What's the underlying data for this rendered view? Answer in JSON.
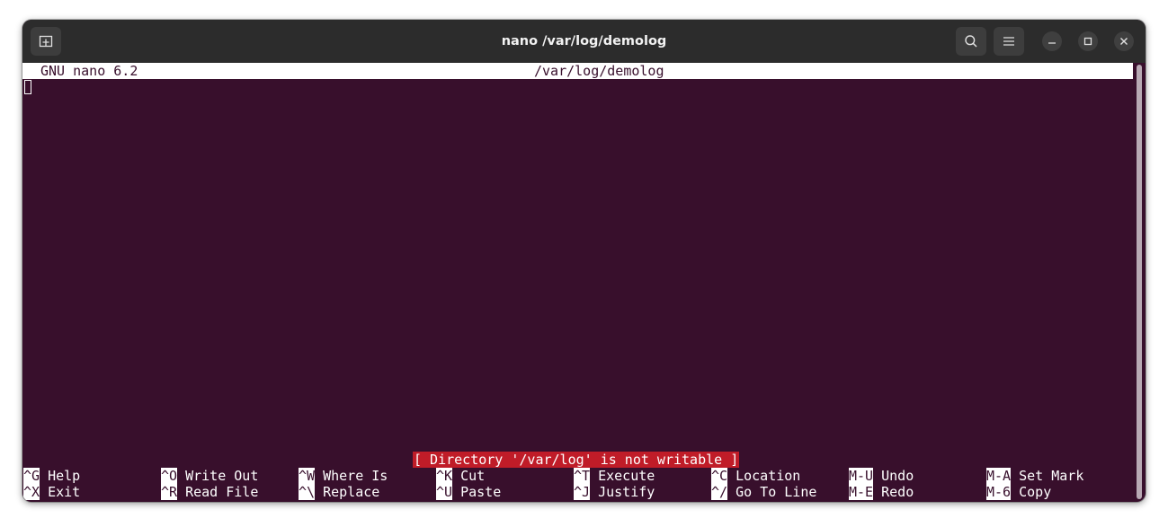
{
  "window": {
    "title": "nano /var/log/demolog",
    "new_tab_icon": "new-tab-icon",
    "search_icon": "search-icon",
    "menu_icon": "hamburger-menu-icon"
  },
  "nano": {
    "version": "GNU nano 6.2",
    "filename": "/var/log/demolog",
    "status": "[ Directory '/var/log' is not writable ]"
  },
  "shortcuts_row1": [
    {
      "key": "^G",
      "label": "Help"
    },
    {
      "key": "^O",
      "label": "Write Out"
    },
    {
      "key": "^W",
      "label": "Where Is"
    },
    {
      "key": "^K",
      "label": "Cut"
    },
    {
      "key": "^T",
      "label": "Execute"
    },
    {
      "key": "^C",
      "label": "Location"
    },
    {
      "key": "M-U",
      "label": "Undo"
    },
    {
      "key": "M-A",
      "label": "Set Mark"
    }
  ],
  "shortcuts_row2": [
    {
      "key": "^X",
      "label": "Exit"
    },
    {
      "key": "^R",
      "label": "Read File"
    },
    {
      "key": "^\\",
      "label": "Replace"
    },
    {
      "key": "^U",
      "label": "Paste"
    },
    {
      "key": "^J",
      "label": "Justify"
    },
    {
      "key": "^/",
      "label": "Go To Line"
    },
    {
      "key": "M-E",
      "label": "Redo"
    },
    {
      "key": "M-6",
      "label": "Copy"
    }
  ],
  "colors": {
    "terminal_bg": "#380f2c",
    "titlebar_bg": "#2c2c2c",
    "status_bg": "#c01c28"
  }
}
